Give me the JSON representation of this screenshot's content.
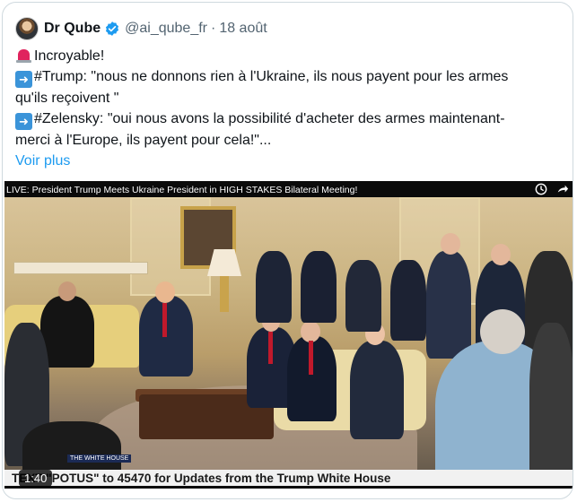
{
  "post": {
    "author_name": "Dr Qube",
    "handle": "@ai_qube_fr",
    "separator": "·",
    "date": "18 août",
    "lines": [
      {
        "emoji": "siren-emoji",
        "text": "Incroyable!"
      },
      {
        "emoji": "arrow-right-emoji",
        "text": "#Trump: \"nous ne donnons rien à l'Ukraine, ils nous payent pour les armes"
      },
      {
        "emoji": "",
        "text": "qu'ils reçoivent \""
      },
      {
        "emoji": "arrow-right-emoji",
        "text": "#Zelensky: \"oui nous avons la possibilité d'acheter des armes maintenant-"
      },
      {
        "emoji": "",
        "text": "merci à l'Europe, ils payent pour cela!\"..."
      }
    ],
    "show_more": "Voir plus"
  },
  "video": {
    "caption": "LIVE: President Trump Meets Ukraine President in HIGH STAKES Bilateral Meeting!",
    "ticker": "TEXT \"POTUS\" to 45470 for Updates from the Trump White House",
    "logo_text": "THE WHITE HOUSE",
    "duration": "1:40"
  },
  "colors": {
    "accent": "#1d9bf0",
    "verified": "#1d9bf0",
    "secondary_text": "#536471"
  }
}
